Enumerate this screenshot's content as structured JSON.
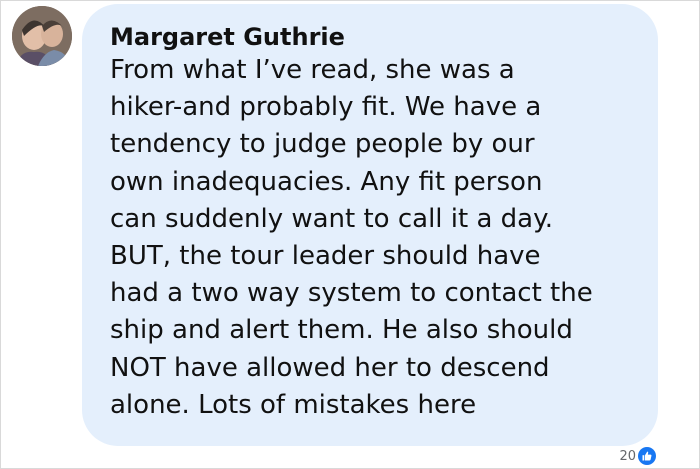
{
  "comment": {
    "author": "Margaret Guthrie",
    "text_lines": [
      "From what I’ve read, she was a",
      "hiker-and probably fit. We have a",
      "tendency to judge people by our",
      "own inadequacies. Any fit person",
      "can suddenly want to call it a day.",
      "BUT, the tour leader should have",
      "had a two way system to contact the",
      "ship and alert them. He also should",
      "NOT have allowed her to descend",
      "alone. Lots of mistakes here"
    ],
    "reaction_count": "20",
    "reaction_icon": "like-icon"
  },
  "colors": {
    "bubble": "#e4effc",
    "text": "#111111",
    "reaction_count": "#65676b",
    "like": "#1877f2"
  }
}
